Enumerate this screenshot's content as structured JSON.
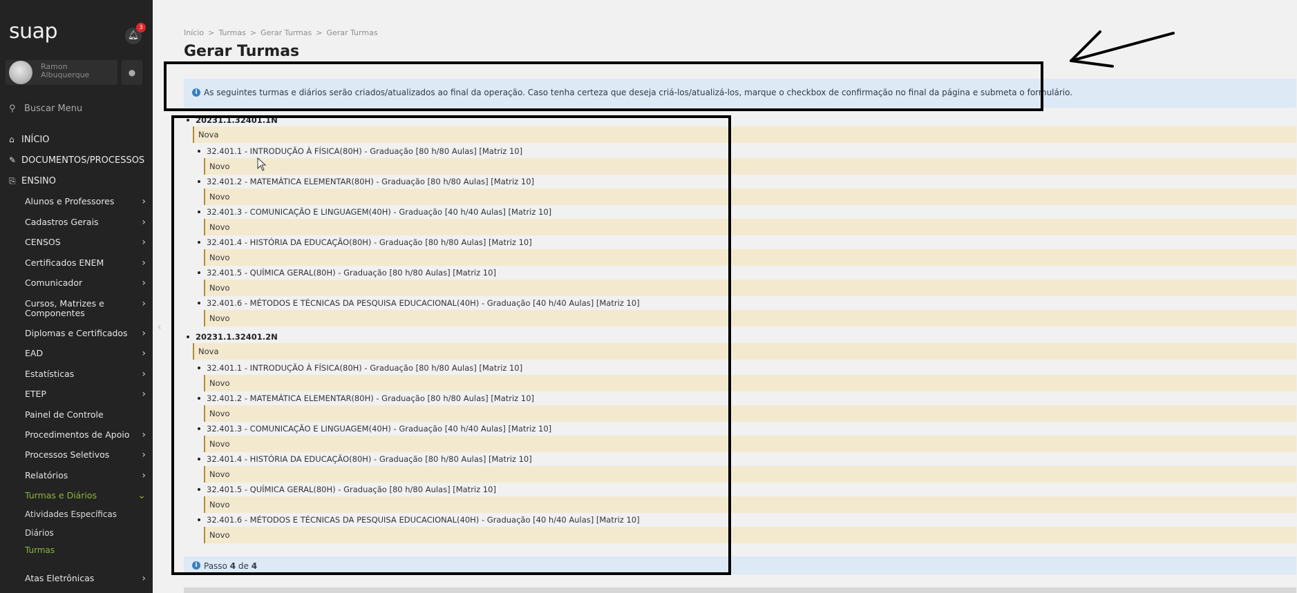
{
  "sidebar": {
    "logo": "suap",
    "notification_count": "3",
    "user_name": "Ramon Albuquerque",
    "search_label": "Buscar Menu",
    "top_items": [
      {
        "label": "INÍCIO",
        "icon": "home-icon"
      },
      {
        "label": "DOCUMENTOS/PROCESSOS",
        "icon": "documents-icon"
      },
      {
        "label": "ENSINO",
        "icon": "teaching-icon"
      }
    ],
    "submenu": [
      {
        "label": "Alunos e Professores"
      },
      {
        "label": "Cadastros Gerais"
      },
      {
        "label": "CENSOS"
      },
      {
        "label": "Certificados ENEM"
      },
      {
        "label": "Comunicador"
      },
      {
        "label": "Cursos, Matrizes e Componentes"
      },
      {
        "label": "Diplomas e Certificados"
      },
      {
        "label": "EAD"
      },
      {
        "label": "Estatísticas"
      },
      {
        "label": "ETEP"
      },
      {
        "label": "Painel de Controle"
      },
      {
        "label": "Procedimentos de Apoio"
      },
      {
        "label": "Processos Seletivos"
      },
      {
        "label": "Relatórios"
      },
      {
        "label": "Turmas e Diários"
      }
    ],
    "leaves": [
      {
        "label": "Atividades Específicas"
      },
      {
        "label": "Diários"
      },
      {
        "label": "Turmas"
      }
    ],
    "last_item": "Atas Eletrônicas",
    "accent_color": "#8bb73b"
  },
  "breadcrumb": [
    "Início",
    "Turmas",
    "Gerar Turmas",
    "Gerar Turmas"
  ],
  "page_title": "Gerar Turmas",
  "info_message": "As seguintes turmas e diários serão criados/atualizados ao final da operação. Caso tenha certeza que deseja criá-los/atualizá-los, marque o checkbox de confirmação no final da página e submeta o formulário.",
  "turmas": [
    {
      "code": "20231.1.32401.1N",
      "status": "Nova",
      "diarios": [
        {
          "label": "32.401.1 - INTRODUÇÃO À FÍSICA(80H) - Graduação [80 h/80 Aulas] [Matriz 10]",
          "status": "Novo"
        },
        {
          "label": "32.401.2 - MATEMÁTICA ELEMENTAR(80H) - Graduação [80 h/80 Aulas] [Matriz 10]",
          "status": "Novo"
        },
        {
          "label": "32.401.3 - COMUNICAÇÃO E LINGUAGEM(40H) - Graduação [40 h/40 Aulas] [Matriz 10]",
          "status": "Novo"
        },
        {
          "label": "32.401.4 - HISTÓRIA DA EDUCAÇÃO(80H) - Graduação [80 h/80 Aulas] [Matriz 10]",
          "status": "Novo"
        },
        {
          "label": "32.401.5 - QUÍMICA GERAL(80H) - Graduação [80 h/80 Aulas] [Matriz 10]",
          "status": "Novo"
        },
        {
          "label": "32.401.6 - MÉTODOS E TÉCNICAS DA PESQUISA EDUCACIONAL(40H) - Graduação [40 h/40 Aulas] [Matriz 10]",
          "status": "Novo"
        }
      ]
    },
    {
      "code": "20231.1.32401.2N",
      "status": "Nova",
      "diarios": [
        {
          "label": "32.401.1 - INTRODUÇÃO À FÍSICA(80H) - Graduação [80 h/80 Aulas] [Matriz 10]",
          "status": "Novo"
        },
        {
          "label": "32.401.2 - MATEMÁTICA ELEMENTAR(80H) - Graduação [80 h/80 Aulas] [Matriz 10]",
          "status": "Novo"
        },
        {
          "label": "32.401.3 - COMUNICAÇÃO E LINGUAGEM(40H) - Graduação [40 h/40 Aulas] [Matriz 10]",
          "status": "Novo"
        },
        {
          "label": "32.401.4 - HISTÓRIA DA EDUCAÇÃO(80H) - Graduação [80 h/80 Aulas] [Matriz 10]",
          "status": "Novo"
        },
        {
          "label": "32.401.5 - QUÍMICA GERAL(80H) - Graduação [80 h/80 Aulas] [Matriz 10]",
          "status": "Novo"
        },
        {
          "label": "32.401.6 - MÉTODOS E TÉCNICAS DA PESQUISA EDUCACIONAL(40H) - Graduação [40 h/40 Aulas] [Matriz 10]",
          "status": "Novo"
        }
      ]
    }
  ],
  "step": {
    "prefix": "Passo",
    "current": "4",
    "middle": "de",
    "total": "4"
  }
}
